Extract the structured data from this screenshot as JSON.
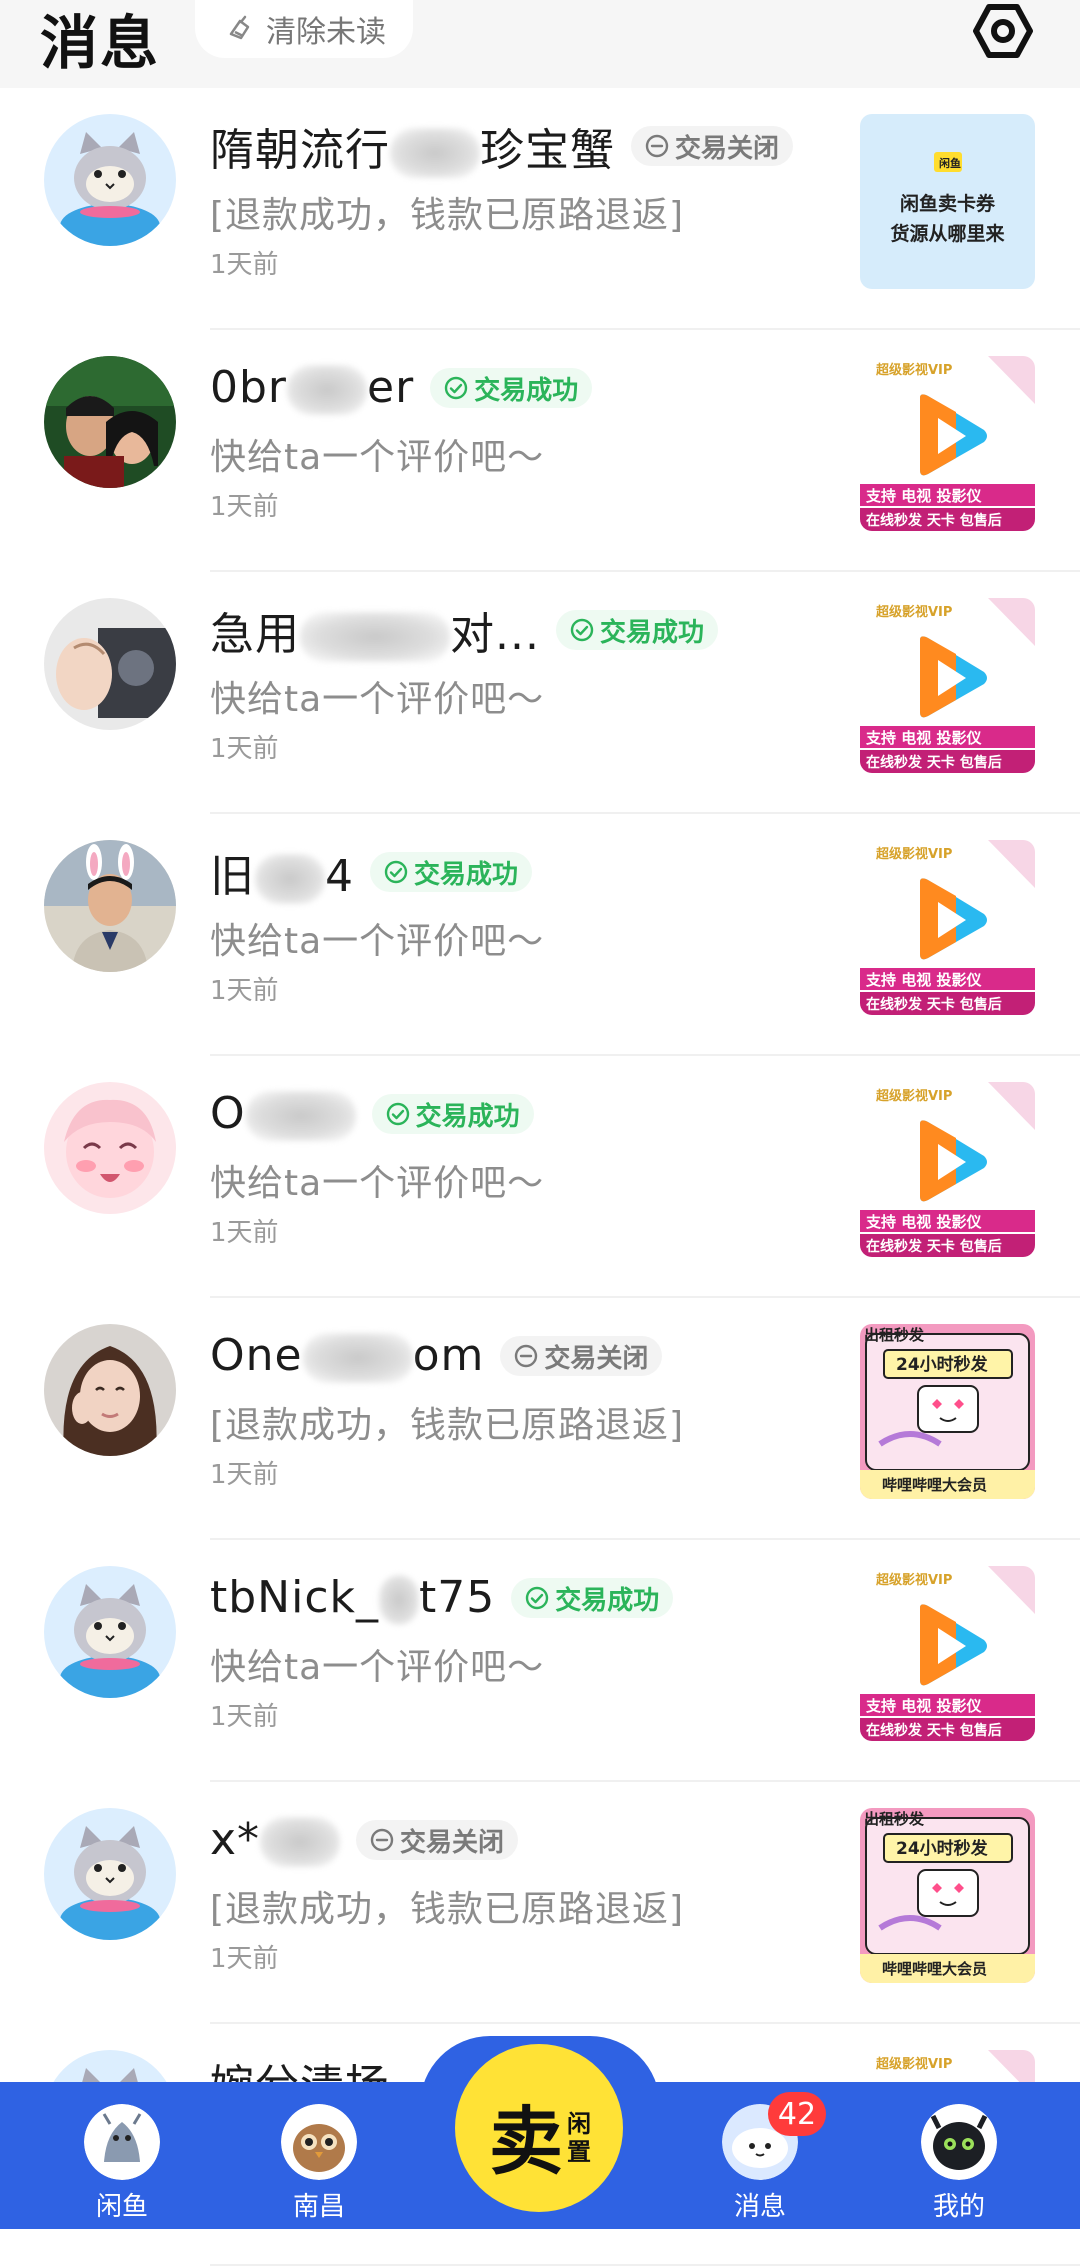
{
  "header": {
    "title": "消息",
    "clear_unread_label": "清除未读"
  },
  "colors": {
    "accent_blue": "#2f62e3",
    "success_green": "#2bb45a",
    "sell_yellow": "#ffe236",
    "badge_red": "#ff3b3b"
  },
  "conversations": [
    {
      "name_left": "隋朝流行",
      "name_right": "珍宝蟹",
      "status": "交易关闭",
      "status_type": "closed",
      "preview": "[退款成功，钱款已原路退返]",
      "time": "1天前",
      "avatar": "cat-mascot-avatar",
      "thumb": "card-voucher-thumbnail",
      "thumb_line1": "闲鱼卖卡券",
      "thumb_line2": "货源从哪里来"
    },
    {
      "name_left": "0br",
      "name_right": "er",
      "status": "交易成功",
      "status_type": "success",
      "preview": "快给ta一个评价吧～",
      "time": "1天前",
      "avatar": "couple-photo-avatar",
      "thumb": "video-vip-thumbnail"
    },
    {
      "name_left": "急用",
      "name_right": "对...",
      "status": "交易成功",
      "status_type": "success",
      "preview": "快给ta一个评价吧～",
      "time": "1天前",
      "avatar": "hand-photo-avatar",
      "thumb": "video-vip-thumbnail"
    },
    {
      "name_left": "旧",
      "name_right": "4",
      "status": "交易成功",
      "status_type": "success",
      "preview": "快给ta一个评价吧～",
      "time": "1天前",
      "avatar": "bunny-ears-man-avatar",
      "thumb": "video-vip-thumbnail"
    },
    {
      "name_left": "O",
      "name_right": "",
      "status": "交易成功",
      "status_type": "success",
      "preview": "快给ta一个评价吧～",
      "time": "1天前",
      "avatar": "anime-girl-avatar",
      "thumb": "video-vip-thumbnail"
    },
    {
      "name_left": "One",
      "name_right": "om",
      "status": "交易关闭",
      "status_type": "closed",
      "preview": "[退款成功，钱款已原路退返]",
      "time": "1天前",
      "avatar": "woman-portrait-avatar",
      "thumb": "bilibili-vip-thumbnail"
    },
    {
      "name_left": "tbNick_",
      "name_right": "t75",
      "status": "交易成功",
      "status_type": "success",
      "preview": "快给ta一个评价吧～",
      "time": "1天前",
      "avatar": "cat-mascot-avatar",
      "thumb": "video-vip-thumbnail"
    },
    {
      "name_left": "x*",
      "name_right": "",
      "status": "交易关闭",
      "status_type": "closed",
      "preview": "[退款成功，钱款已原路退返]",
      "time": "1天前",
      "avatar": "cat-mascot-avatar",
      "thumb": "bilibili-vip-thumbnail"
    },
    {
      "name_left": "婉兮清扬",
      "name_right": "",
      "status": "",
      "status_type": "success",
      "preview": "",
      "time": "",
      "avatar": "cat-mascot-avatar",
      "thumb": "video-vip-thumbnail"
    }
  ],
  "tabbar": {
    "tabs": [
      {
        "label": "闲鱼",
        "icon": "dragon-icon"
      },
      {
        "label": "南昌",
        "icon": "owl-icon"
      },
      {
        "label": "消息",
        "icon": "cloud-pet-icon",
        "badge": "42"
      },
      {
        "label": "我的",
        "icon": "black-dragon-icon"
      }
    ],
    "sell": {
      "main": "卖",
      "sub1": "闲",
      "sub2": "置"
    }
  }
}
